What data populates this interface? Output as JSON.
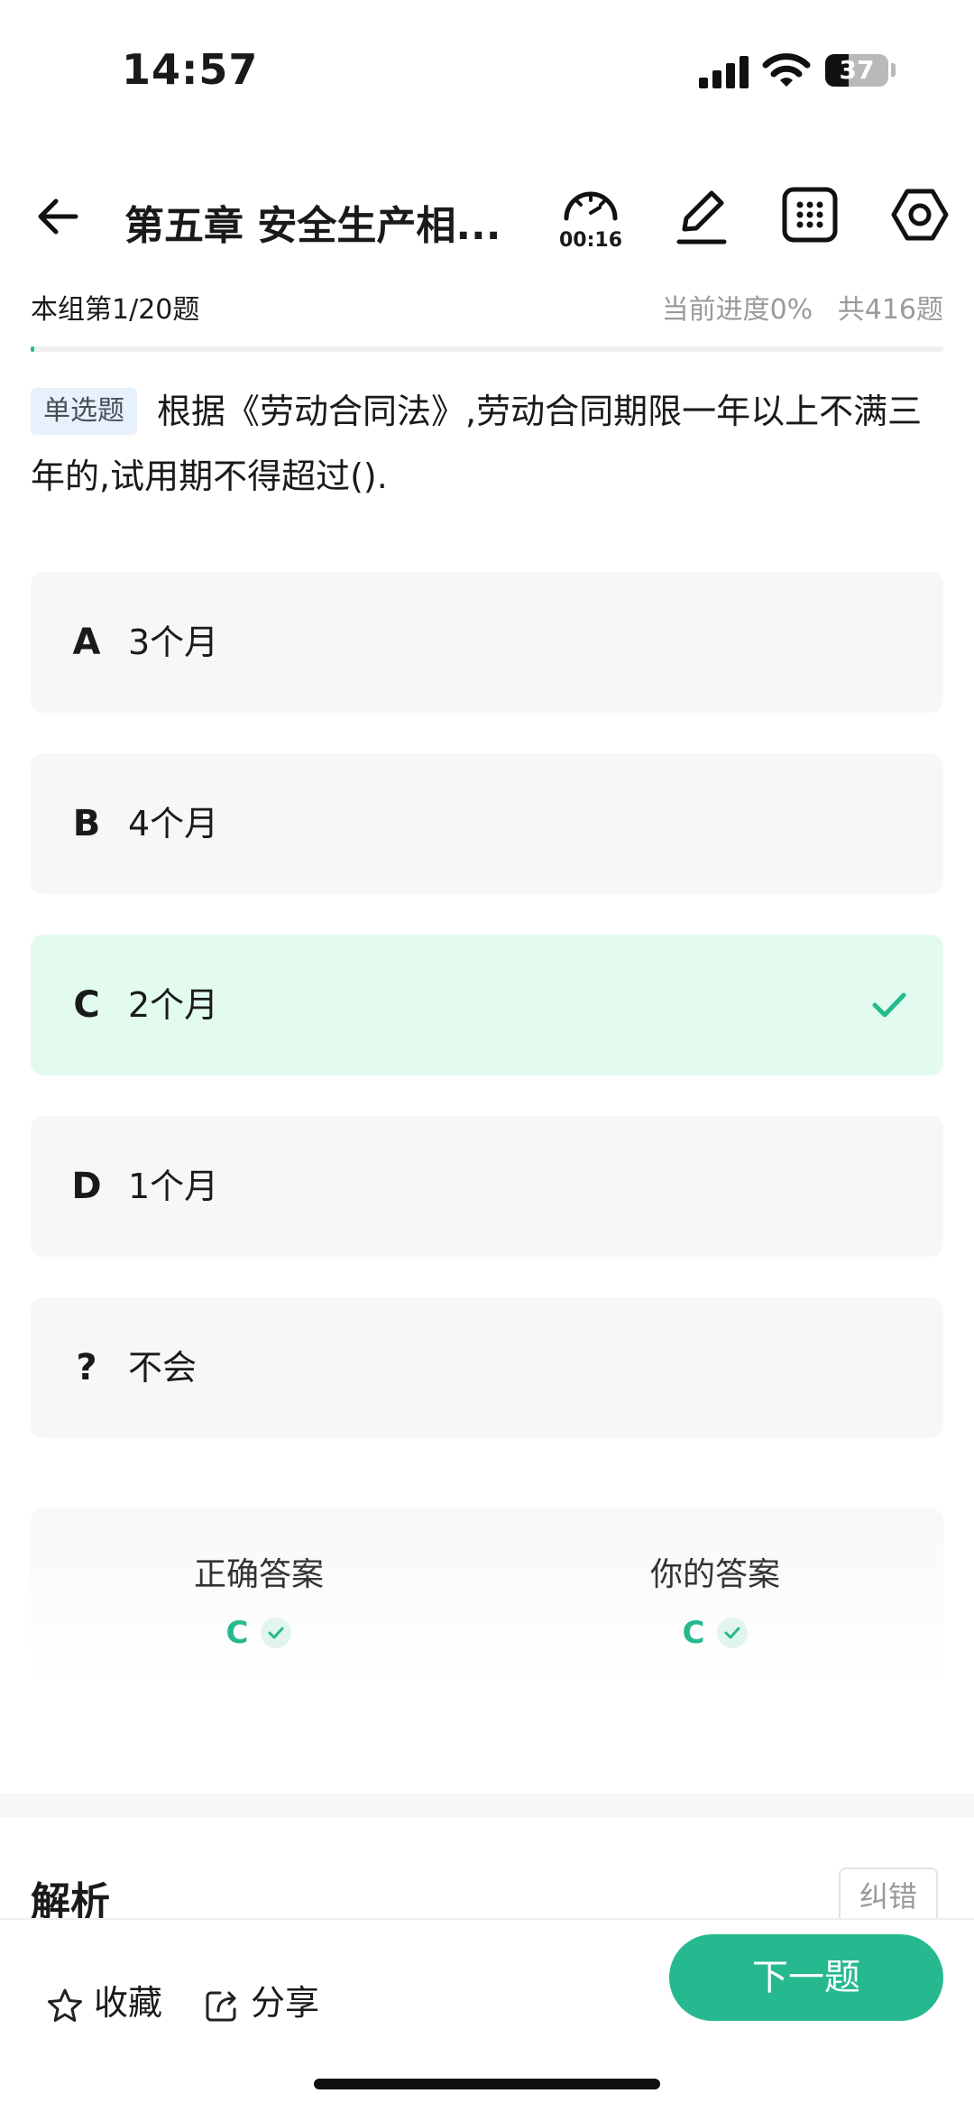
{
  "status_bar": {
    "time": "14:57",
    "battery_level": "37"
  },
  "header": {
    "title": "第五章 安全生产相...",
    "timer": "00:16"
  },
  "progress": {
    "group_position": "本组第1/20题",
    "current_progress": "当前进度0%",
    "total": "共416题",
    "fraction": 0
  },
  "question": {
    "type_badge": "单选题",
    "text": "根据《劳动合同法》,劳动合同期限一年以上不满三年的,试用期不得超过()."
  },
  "options": [
    {
      "letter": "A",
      "text": "3个月",
      "state": "normal"
    },
    {
      "letter": "B",
      "text": "4个月",
      "state": "normal"
    },
    {
      "letter": "C",
      "text": "2个月",
      "state": "correct"
    },
    {
      "letter": "D",
      "text": "1个月",
      "state": "normal"
    },
    {
      "letter": "?",
      "text": "不会",
      "state": "normal"
    }
  ],
  "answer_card": {
    "correct_label": "正确答案",
    "correct_value": "C",
    "yours_label": "你的答案",
    "yours_value": "C"
  },
  "analysis": {
    "title": "解析",
    "report_error_label": "纠错"
  },
  "bottom_bar": {
    "favorite_label": "收藏",
    "share_label": "分享",
    "next_label": "下一题"
  },
  "colors": {
    "accent": "#26b98f",
    "correct_bg": "#e3fbee",
    "option_bg": "#f7f7f7",
    "type_badge_bg": "#e7f1fc"
  }
}
